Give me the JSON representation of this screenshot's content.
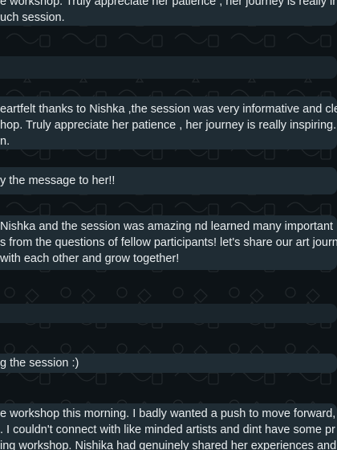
{
  "messages": [
    {
      "id": "m1",
      "lines": [
        "e workshop. Truly appreciate her patience , her journey is really ins",
        "uch session."
      ]
    },
    {
      "id": "m2",
      "lines": []
    },
    {
      "id": "m3",
      "lines": [
        "eartfelt thanks to Nishka ,the session was very informative and cleared",
        "hop. Truly appreciate her patience , her journey is really inspiring. Look",
        "n."
      ]
    },
    {
      "id": "m4",
      "lines": [
        "y the message to her!!"
      ]
    },
    {
      "id": "m5",
      "lines": [
        " Nishka and the session was amazing nd learned many important",
        "s from the questions of fellow participants! let's share our art journ",
        "with each other and grow together!"
      ]
    },
    {
      "id": "m6",
      "lines": []
    },
    {
      "id": "m7",
      "lines": [
        "g the session :)"
      ]
    },
    {
      "id": "m8",
      "lines": [
        "e workshop this morning. I badly wanted a push to move forward, s",
        ". I couldn't connect with like minded artists and dint have some pr",
        "ing workshop. Nishika had genuinely shared her experiences and jo"
      ]
    }
  ],
  "colors": {
    "background": "#0d1317",
    "bubble": "#1f2c34",
    "text": "#e9edef"
  }
}
